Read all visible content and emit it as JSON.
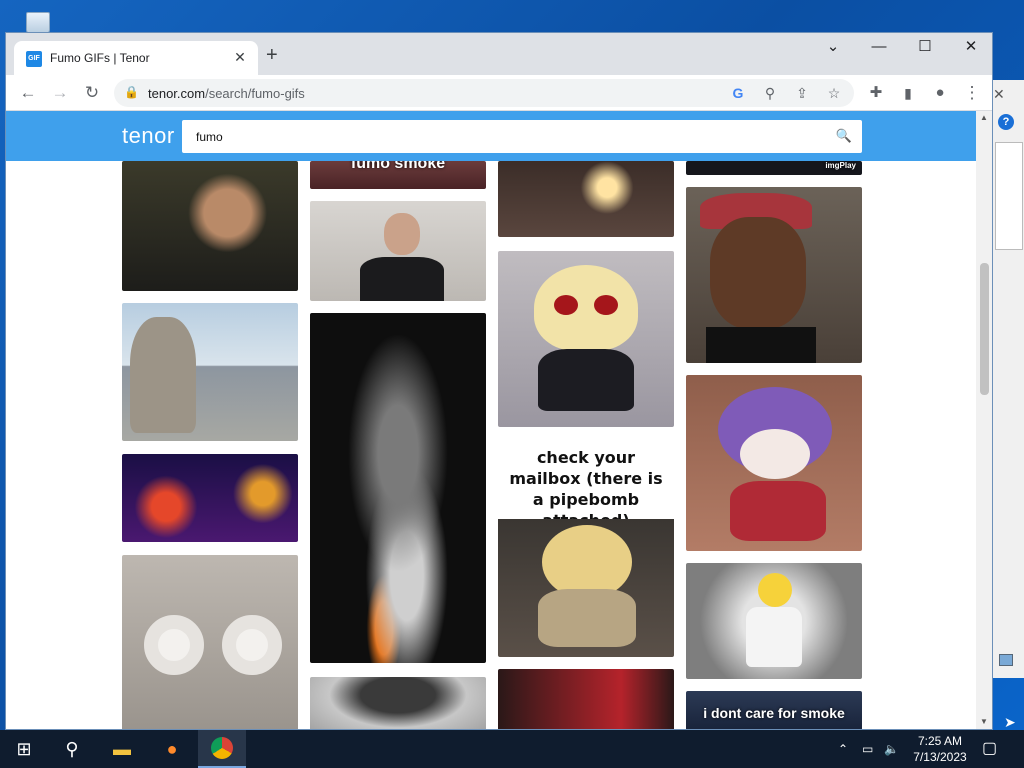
{
  "browser": {
    "tab_title": "Fumo GIFs | Tenor",
    "favicon_text": "GIF",
    "url_host": "tenor.com",
    "url_path": "/search/fumo-gifs"
  },
  "tenor": {
    "logo": "tenor",
    "search_value": "fumo"
  },
  "gifs": {
    "c1_top_caption": "fumo smoke",
    "c3_mailbox_caption": "check your mailbox (there is a pipebomb attached)",
    "c4_top_label": "imgPlay",
    "c4_bottom_caption": "i dont care for smoke"
  },
  "taskbar": {
    "time": "7:25 AM",
    "date": "7/13/2023"
  }
}
